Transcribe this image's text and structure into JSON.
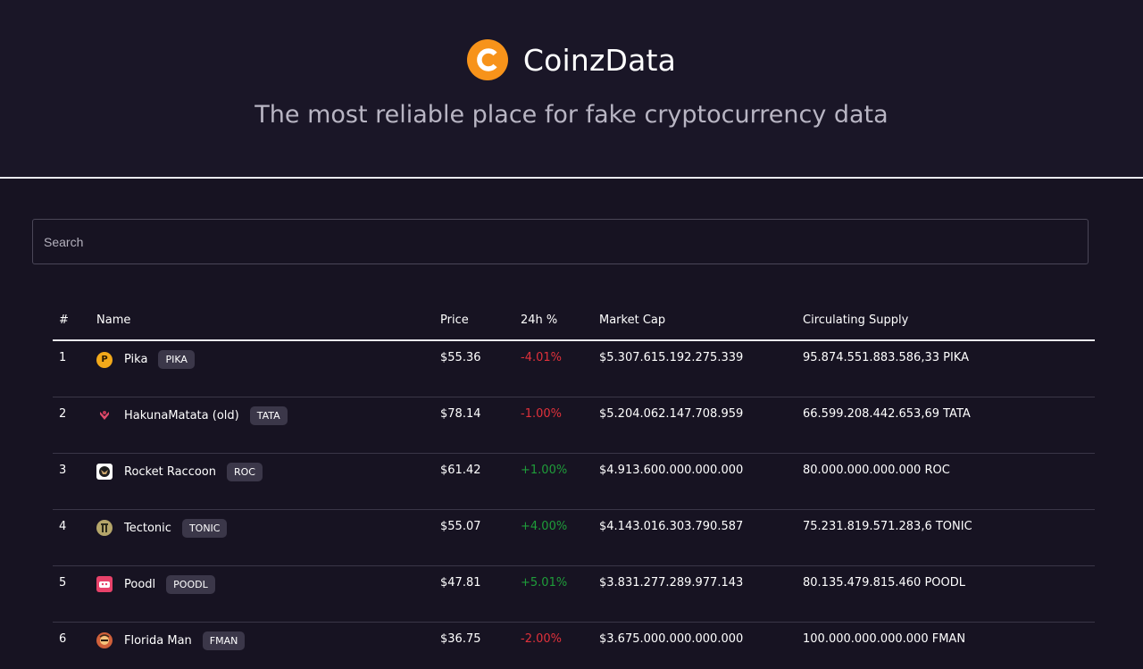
{
  "brand": {
    "logo_letter": "C",
    "name": "CoinzData",
    "tagline": "The most reliable place for fake cryptocurrency data",
    "accent": "#f7931a"
  },
  "search": {
    "placeholder": "Search",
    "value": ""
  },
  "table": {
    "headers": [
      "#",
      "Name",
      "Price",
      "24h %",
      "Market Cap",
      "Circulating Supply"
    ],
    "rows": [
      {
        "rank": "1",
        "name": "Pika",
        "symbol": "PIKA",
        "icon": "pika-icon",
        "price": "$55.36",
        "change": "-4.01%",
        "change_dir": "negative",
        "market_cap": "$5.307.615.192.275.339",
        "supply": "95.874.551.883.586,33 PIKA"
      },
      {
        "rank": "2",
        "name": "HakunaMatata (old)",
        "symbol": "TATA",
        "icon": "hakunamatata-icon",
        "price": "$78.14",
        "change": "-1.00%",
        "change_dir": "negative",
        "market_cap": "$5.204.062.147.708.959",
        "supply": "66.599.208.442.653,69 TATA"
      },
      {
        "rank": "3",
        "name": "Rocket Raccoon",
        "symbol": "ROC",
        "icon": "rocket-raccoon-icon",
        "price": "$61.42",
        "change": "+1.00%",
        "change_dir": "positive",
        "market_cap": "$4.913.600.000.000.000",
        "supply": "80.000.000.000.000 ROC"
      },
      {
        "rank": "4",
        "name": "Tectonic",
        "symbol": "TONIC",
        "icon": "tectonic-icon",
        "price": "$55.07",
        "change": "+4.00%",
        "change_dir": "positive",
        "market_cap": "$4.143.016.303.790.587",
        "supply": "75.231.819.571.283,6 TONIC"
      },
      {
        "rank": "5",
        "name": "Poodl",
        "symbol": "POODL",
        "icon": "poodl-icon",
        "price": "$47.81",
        "change": "+5.01%",
        "change_dir": "positive",
        "market_cap": "$3.831.277.289.977.143",
        "supply": "80.135.479.815.460 POODL"
      },
      {
        "rank": "6",
        "name": "Florida Man",
        "symbol": "FMAN",
        "icon": "florida-man-icon",
        "price": "$36.75",
        "change": "-2.00%",
        "change_dir": "negative",
        "market_cap": "$3.675.000.000.000.000",
        "supply": "100.000.000.000.000 FMAN"
      }
    ]
  },
  "colors": {
    "background": "#171322",
    "negative": "#e0313b",
    "positive": "#1f9d3a",
    "badge": "#3b3749"
  }
}
